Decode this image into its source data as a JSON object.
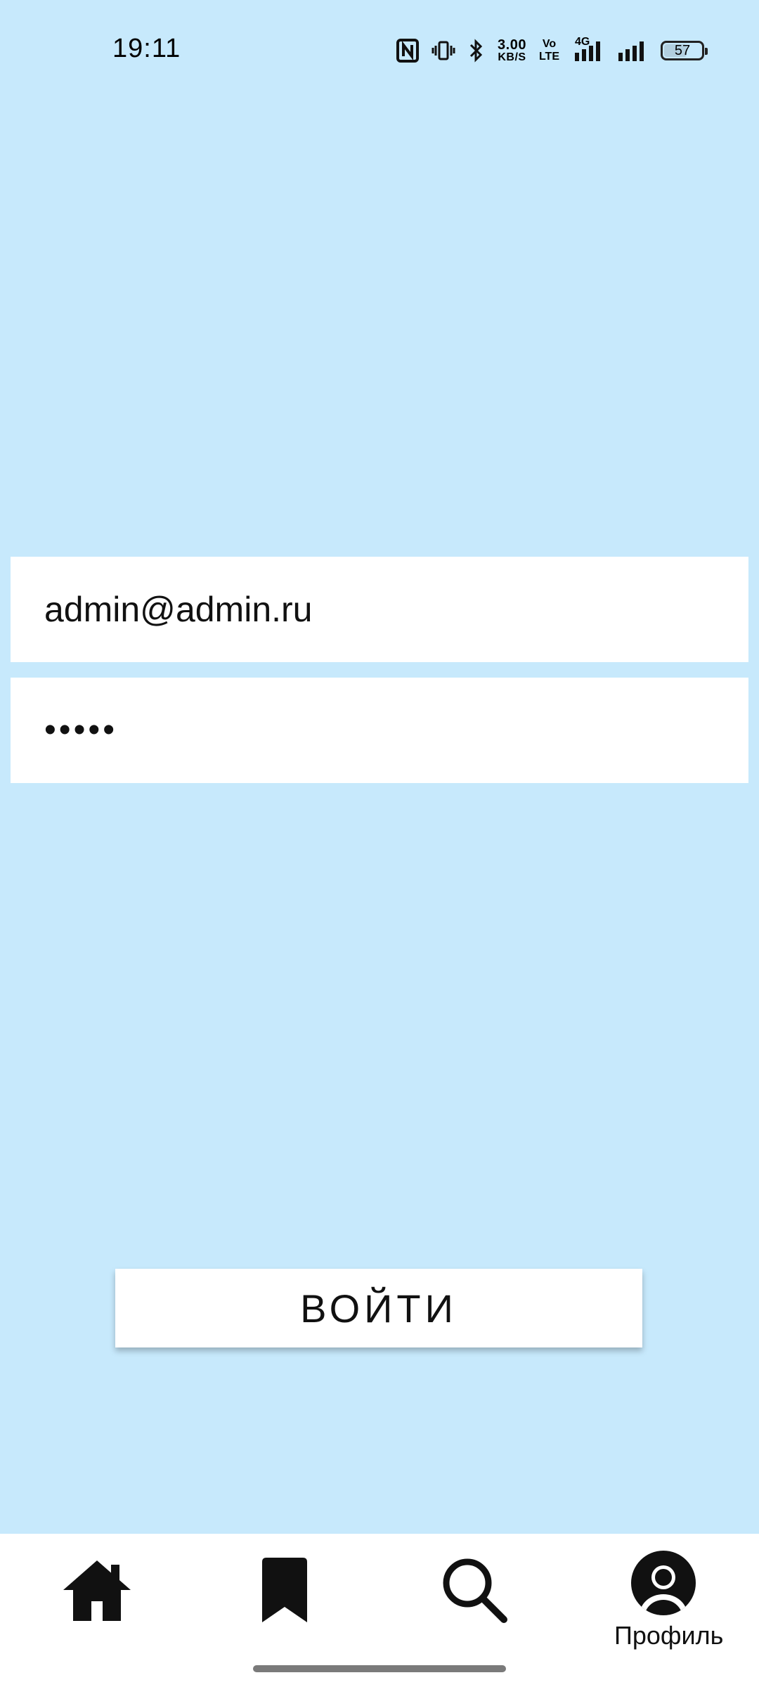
{
  "status_bar": {
    "time": "19:11",
    "speed_value": "3.00",
    "speed_unit": "KB/S",
    "volte_top": "Vo",
    "volte_bottom": "LTE",
    "network": "4G",
    "battery_level": "57",
    "icons": [
      "nfc-icon",
      "vibrate-icon",
      "bluetooth-icon",
      "signal-icon",
      "signal-icon",
      "battery-icon"
    ]
  },
  "login_form": {
    "email_value": "admin@admin.ru",
    "password_mask": "•••••",
    "login_button_label": "ВОЙТИ"
  },
  "bottom_nav": {
    "items": [
      {
        "icon": "home-icon"
      },
      {
        "icon": "bookmark-icon"
      },
      {
        "icon": "search-icon"
      },
      {
        "icon": "profile-icon",
        "label": "Профиль"
      }
    ]
  },
  "colors": {
    "background": "#C7E9FC",
    "surface": "#FFFFFF",
    "text": "#000000"
  }
}
